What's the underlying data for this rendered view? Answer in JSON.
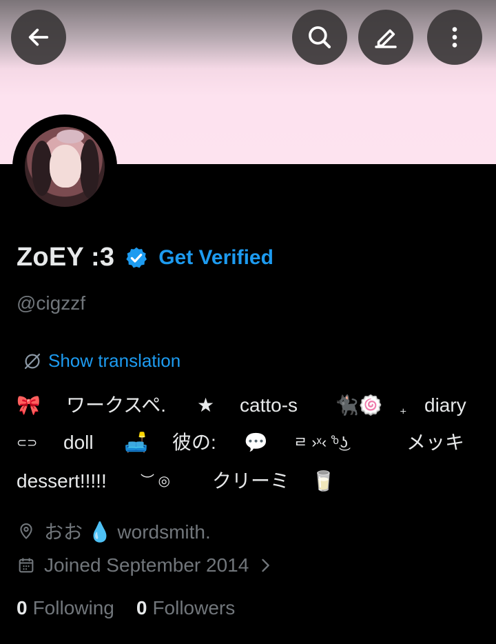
{
  "profile": {
    "name": "ZoEY :3",
    "verify_cta": "Get Verified",
    "handle": "@cigzzf",
    "show_translation": "Show translation",
    "bio": {
      "line1": [
        "🎀",
        "ワークスペ.",
        "★",
        "catto-s",
        "🐈‍⬛🍥",
        "₊",
        "diary"
      ],
      "line2": [
        "⊂⊃",
        "doll",
        "🛋️",
        "彼の:",
        "💬",
        "ㄹ ›ˣ‹ ˚ͦ ͜ʖ",
        "メッキ"
      ],
      "line3": [
        "dessert!!!!!",
        "︶ ◎",
        "クリーミ",
        "🥛"
      ]
    },
    "location": "おお  💧  wordsmith.",
    "joined": "Joined September 2014",
    "following_count": "0",
    "following_label": "Following",
    "followers_count": "0",
    "followers_label": "Followers"
  },
  "icons": {
    "back": "arrow-left-icon",
    "search": "search-icon",
    "edit": "pencil-icon",
    "more": "more-vertical-icon",
    "verified": "verified-badge-icon",
    "translate": "globe-slash-icon",
    "location": "location-pin-icon",
    "calendar": "calendar-icon",
    "chevron": "chevron-right-icon"
  },
  "colors": {
    "accent": "#1d9bf0",
    "banner": "#fde2ef",
    "text": "#e7e9ea",
    "muted": "#71767b"
  }
}
